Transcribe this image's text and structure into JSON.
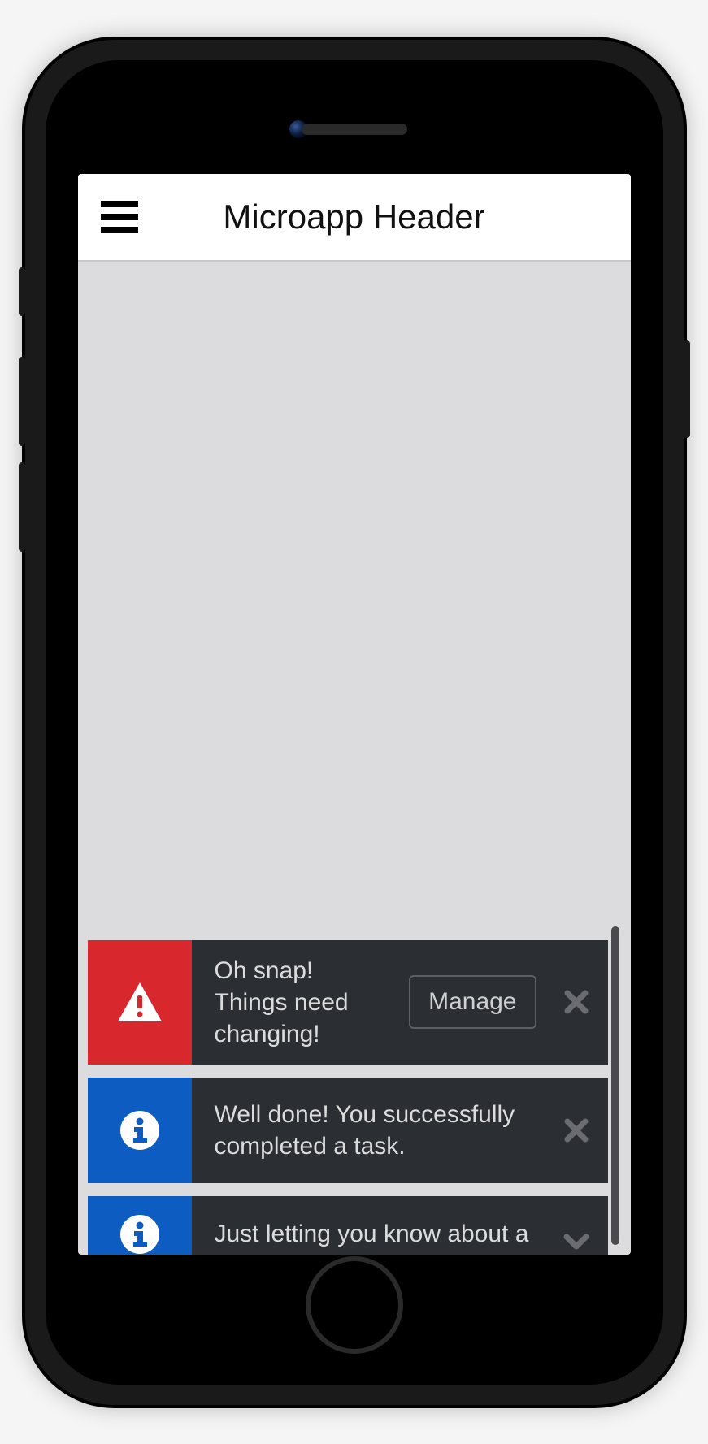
{
  "header": {
    "title": "Microapp Header"
  },
  "toasts": [
    {
      "type": "error",
      "icon": "warning-triangle-icon",
      "color": "#d9272e",
      "message": "Oh snap! Things need changing!",
      "action_label": "Manage",
      "dismiss_icon": "close-icon"
    },
    {
      "type": "info",
      "icon": "info-circle-icon",
      "color": "#0c5cc2",
      "message": "Well done! You successfully completed a task.",
      "dismiss_icon": "close-icon"
    },
    {
      "type": "info",
      "icon": "info-circle-icon",
      "color": "#0c5cc2",
      "message": "Just letting you know about a",
      "dismiss_icon": "chevron-down-icon"
    }
  ]
}
